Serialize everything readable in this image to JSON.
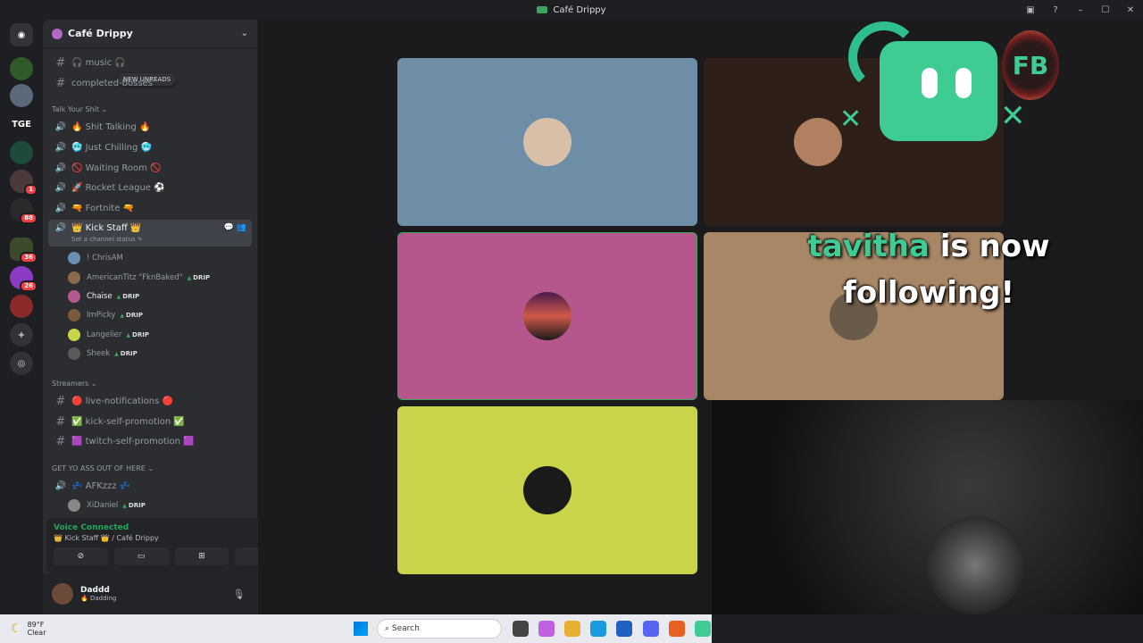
{
  "window": {
    "title": "Café Drippy"
  },
  "servers": [
    {
      "name": "server-drippy",
      "badge": ""
    },
    {
      "name": "server-wolf",
      "badge": ""
    },
    {
      "name": "server-tge",
      "label": "TGE"
    },
    {
      "name": "server-ring",
      "badge": ""
    },
    {
      "name": "server-person",
      "badge": "1"
    },
    {
      "name": "server-group",
      "badge": "88"
    },
    {
      "name": "server-apps",
      "badge": "36"
    },
    {
      "name": "server-purple",
      "badge": "26"
    },
    {
      "name": "server-red",
      "badge": ""
    }
  ],
  "guild": {
    "name": "Café Drippy"
  },
  "unreads_pill": "NEW UNREADS",
  "channels": {
    "top": [
      {
        "label": "🎧 music 🎧",
        "type": "text"
      },
      {
        "label": "completed-bosses",
        "type": "text"
      }
    ],
    "cat1": "Talk Your Shit ⌄",
    "voice": [
      {
        "label": "🔥 Shit Talking 🔥"
      },
      {
        "label": "🥶 Just Chilling 🥶"
      },
      {
        "label": "🚫 Waiting Room 🚫"
      },
      {
        "label": "🚀 Rocket League ⚽"
      },
      {
        "label": "🔫 Fortnite 🔫"
      }
    ],
    "active": {
      "label": "👑 Kick Staff 👑",
      "status": "Set a channel status ✎"
    },
    "members": [
      {
        "name": "! ChrisAM",
        "tag": "",
        "color": "#6a8fb0"
      },
      {
        "name": "AmericanTitz \"FknBaked\"",
        "tag": "DRIP",
        "color": "#8a6a4a"
      },
      {
        "name": "Chaise",
        "tag": "DRIP",
        "color": "#b35a8f"
      },
      {
        "name": "ImPicky",
        "tag": "DRIP",
        "color": "#7a5a3a"
      },
      {
        "name": "Langelier",
        "tag": "DRIP",
        "color": "#c8d44a"
      },
      {
        "name": "Sheek",
        "tag": "DRIP",
        "color": "#5a5a5a"
      }
    ],
    "cat2": "Streamers ⌄",
    "streamers": [
      {
        "label": "🔴 live-notifications 🔴"
      },
      {
        "label": "✅ kick-self-promotion ✅"
      },
      {
        "label": "🟪 twitch-self-promotion 🟪"
      }
    ],
    "cat3": "GET YO ASS OUT OF HERE ⌄",
    "afk": {
      "label": "💤 AFKzzz 💤"
    },
    "afk_member": {
      "name": "XiDaniel",
      "tag": "DRIP",
      "color": "#888"
    }
  },
  "voice_panel": {
    "status": "Voice Connected",
    "location": "👑 Kick Staff 👑 / Café Drippy"
  },
  "user": {
    "name": "Daddd",
    "status": "🔥 Dadding"
  },
  "tiles": [
    {
      "name": "tile-chrisam",
      "color": "#6d8ea6"
    },
    {
      "name": "tile-americantitz",
      "color": "#2e2018"
    },
    {
      "name": "tile-chaise",
      "color": "#b5578c"
    },
    {
      "name": "tile-impicky",
      "color": "#a88767"
    },
    {
      "name": "tile-langelier",
      "color": "#c9d44a"
    }
  ],
  "overlay": {
    "follower": "tavitha",
    "message_1": "is now",
    "message_2": "following!",
    "coin": "FB"
  },
  "taskbar": {
    "temp": "89°F",
    "condition": "Clear",
    "search": "Search"
  }
}
